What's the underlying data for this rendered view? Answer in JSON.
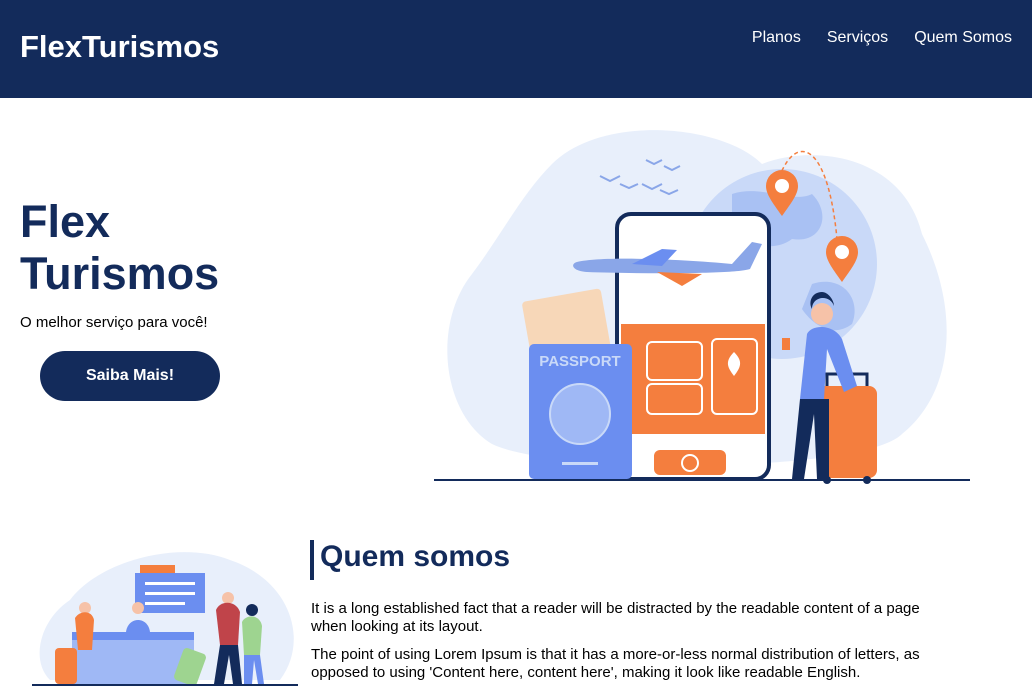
{
  "header": {
    "brand": "FlexTurismos",
    "nav": [
      {
        "label": "Planos"
      },
      {
        "label": "Serviços"
      },
      {
        "label": "Quem Somos"
      }
    ]
  },
  "hero": {
    "title": "Flex Turismos",
    "subtitle": "O melhor serviço para você!",
    "cta_label": "Saiba Mais!",
    "illustration_text": "PASSPORT"
  },
  "about": {
    "title": "Quem somos",
    "paragraphs": [
      "It is a long established fact that a reader will be distracted by the readable content of a page when looking at its layout.",
      "The point of using Lorem Ipsum is that it has a more-or-less normal distribution of letters, as opposed to using 'Content here, content here', making it look like readable English."
    ]
  },
  "colors": {
    "navy": "#132b5b",
    "orange": "#f47e3e",
    "blue": "#6b8ef0",
    "light_blue": "#e8effb"
  }
}
